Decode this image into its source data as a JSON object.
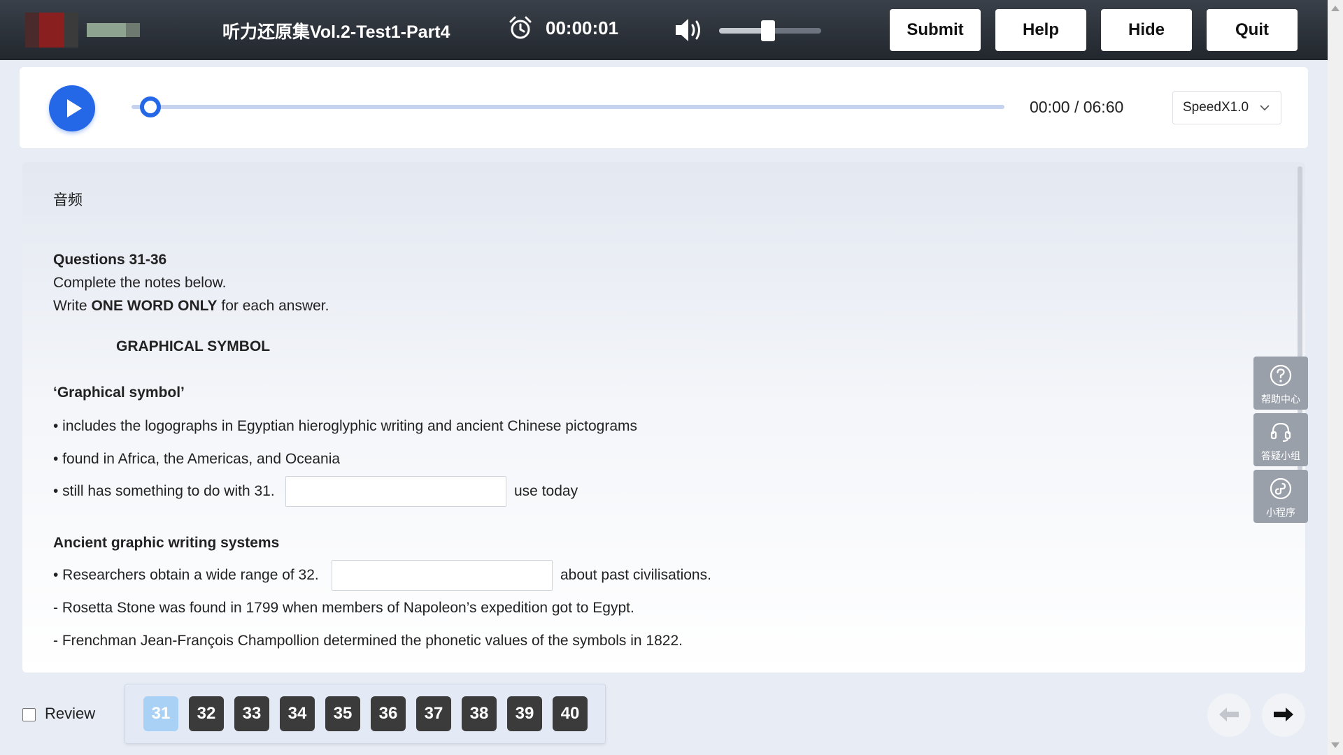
{
  "header": {
    "title": "听力还原集Vol.2-Test1-Part4",
    "timer": "00:00:01",
    "volume_level": 0.48,
    "buttons": {
      "submit": "Submit",
      "help": "Help",
      "hide": "Hide",
      "quit": "Quit"
    }
  },
  "player": {
    "time_readout": "00:00 / 06:60",
    "speed_label": "SpeedX1.0",
    "progress": 0
  },
  "content": {
    "section_label": "音频",
    "questions_range": "Questions 31-36",
    "instruction1": "Complete the notes below.",
    "instruction2_pre": "Write ",
    "instruction2_bold": "ONE WORD ONLY",
    "instruction2_post": " for each answer.",
    "notes_title": "GRAPHICAL SYMBOL",
    "heading1": "‘Graphical symbol’",
    "bullet1": "• includes the logographs in Egyptian hieroglyphic writing and ancient Chinese pictograms",
    "bullet2": "• found in Africa, the Americas, and Oceania",
    "bullet3_pre": "• still has something to do with 31.",
    "bullet3_post": "use today",
    "heading2": "Ancient graphic writing systems",
    "bullet4_pre": "• Researchers obtain a wide range of 32.",
    "bullet4_post": "about past civilisations.",
    "dash1": "- Rosetta Stone was found in 1799 when members of Napoleon’s expedition got to Egypt.",
    "dash2": "- Frenchman Jean-François Champollion determined the phonetic values of the symbols in 1822."
  },
  "widgets": [
    {
      "label": "帮助中心",
      "icon": "question-circle-icon"
    },
    {
      "label": "答疑小组",
      "icon": "headset-icon"
    },
    {
      "label": "小程序",
      "icon": "mini-program-icon"
    }
  ],
  "footer": {
    "review_label": "Review",
    "questions": [
      "31",
      "32",
      "33",
      "34",
      "35",
      "36",
      "37",
      "38",
      "39",
      "40"
    ],
    "active_question": "31"
  }
}
